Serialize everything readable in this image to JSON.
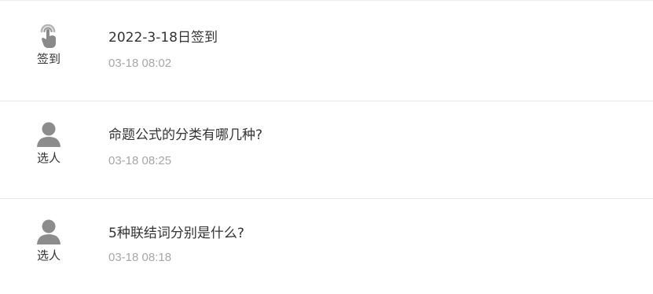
{
  "activities": [
    {
      "icon": "tap-signin-icon",
      "type_label": "签到",
      "title": "2022-3-18日签到",
      "time": "03-18 08:02"
    },
    {
      "icon": "person-icon",
      "type_label": "选人",
      "title": "命题公式的分类有哪几种?",
      "time": "03-18 08:25"
    },
    {
      "icon": "person-icon",
      "type_label": "选人",
      "title": "5种联结词分别是什么?",
      "time": "03-18 08:18"
    }
  ],
  "colors": {
    "title_text": "#333333",
    "time_text": "#a6a6a6",
    "icon_gray": "#8c8c8c",
    "divider": "#e6e6e6"
  }
}
